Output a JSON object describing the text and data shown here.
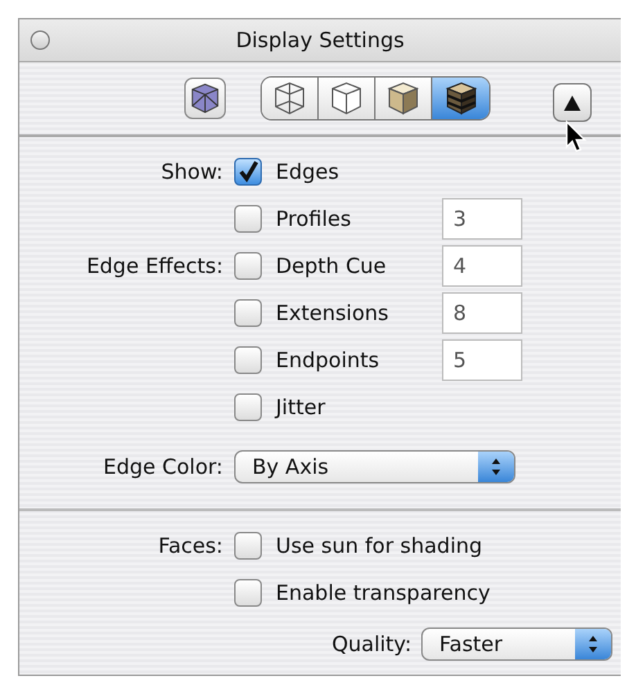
{
  "window": {
    "title": "Display Settings"
  },
  "toolbar": {
    "xray": {
      "selected": false
    },
    "styles": [
      {
        "kind": "wireframe",
        "selected": false
      },
      {
        "kind": "hidden",
        "selected": false
      },
      {
        "kind": "shaded",
        "selected": false
      },
      {
        "kind": "textured",
        "selected": true
      }
    ]
  },
  "edges": [
    {
      "label": "Show:",
      "text": "Edges",
      "checked": true
    },
    {
      "text": "Profiles",
      "checked": false,
      "value": "3"
    },
    {
      "label": "Edge Effects:",
      "text": "Depth Cue",
      "checked": false,
      "value": "4"
    },
    {
      "text": "Extensions",
      "checked": false,
      "value": "8"
    },
    {
      "text": "Endpoints",
      "checked": false,
      "value": "5"
    },
    {
      "text": "Jitter",
      "checked": false
    }
  ],
  "edge_color": {
    "label": "Edge Color:",
    "value": "By Axis"
  },
  "faces": [
    {
      "label": "Faces:",
      "text": "Use sun for shading",
      "checked": false
    },
    {
      "text": "Enable transparency",
      "checked": false
    }
  ],
  "quality": {
    "label": "Quality:",
    "value": "Faster"
  }
}
